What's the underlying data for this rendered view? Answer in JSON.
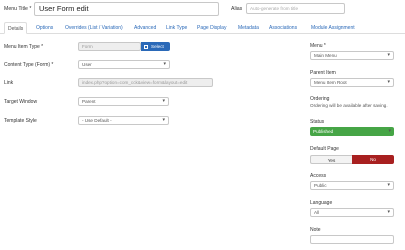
{
  "header": {
    "title_label": "Menu Title *",
    "title_value": "User Form edit",
    "alias_label": "Alias",
    "alias_placeholder": "Auto-generate from title"
  },
  "tabs": [
    {
      "label": "Details",
      "active": true
    },
    {
      "label": "Options"
    },
    {
      "label": "Overrides (List / Variation)"
    },
    {
      "label": "Advanced"
    },
    {
      "label": "Link Type"
    },
    {
      "label": "Page Display"
    },
    {
      "label": "Metadata"
    },
    {
      "label": "Associations"
    },
    {
      "label": "Module Assignment"
    }
  ],
  "details": {
    "item_type_label": "Menu Item Type *",
    "item_type_value": "Form",
    "select_label": "Select",
    "content_type_label": "Content Type (Form) *",
    "content_type_value": "User",
    "link_label": "Link",
    "link_value": "index.php?option=com_cck&view=form&layout=edit",
    "target_window_label": "Target Window",
    "target_window_value": "Parent",
    "template_style_label": "Template Style",
    "template_style_value": "- Use Default -"
  },
  "sidebar": {
    "menu_label": "Menu *",
    "menu_value": "Main Menu",
    "parent_label": "Parent Item",
    "parent_value": "Menu Item Root",
    "ordering_label": "Ordering",
    "ordering_note": "Ordering will be available after saving.",
    "status_label": "Status",
    "status_value": "Published",
    "default_page_label": "Default Page",
    "default_yes": "Yes",
    "default_no": "No",
    "access_label": "Access",
    "access_value": "Public",
    "language_label": "Language",
    "language_value": "All",
    "note_label": "Note",
    "note_value": ""
  },
  "colors": {
    "link_blue": "#2a69b8",
    "published_green": "#46a546",
    "no_red": "#a82020"
  }
}
